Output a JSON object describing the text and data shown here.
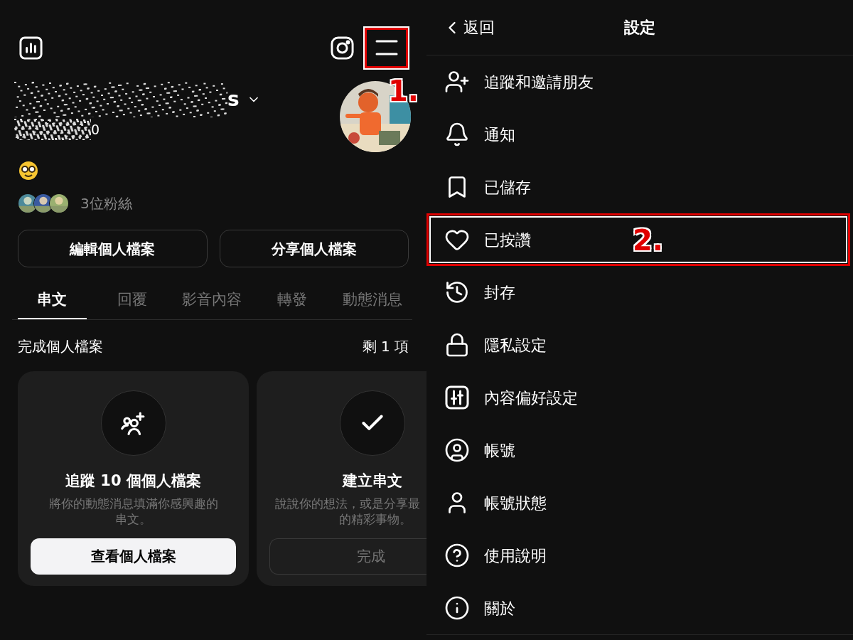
{
  "profile": {
    "header": {
      "menu_button": {
        "annotated": true,
        "marker": "1."
      }
    },
    "name_visible": "s",
    "handle_visible": "0",
    "followers": "3位粉絲",
    "buttons": [
      "編輯個人檔案",
      "分享個人檔案"
    ],
    "tabs": [
      {
        "label": "串文",
        "selected": true
      },
      {
        "label": "回覆",
        "selected": false
      },
      {
        "label": "影音內容",
        "selected": false
      },
      {
        "label": "轉發",
        "selected": false
      },
      {
        "label": "動態消息",
        "selected": false
      }
    ],
    "section": {
      "title": "完成個人檔案",
      "remaining": "剩 1 項"
    },
    "cards": [
      {
        "title": "追蹤 10 個個人檔案",
        "description": [
          "將你的動態消息填滿你感興趣的",
          "串文。"
        ],
        "button": "查看個人檔案",
        "done": false
      },
      {
        "title": "建立串文",
        "description": [
          "說說你的想法，或是分享最",
          "的精彩事物。"
        ],
        "button": "完成",
        "done": true
      }
    ]
  },
  "settings": {
    "back": "返回",
    "title": "設定",
    "items": [
      {
        "label": "追蹤和邀請朋友",
        "annotated": false
      },
      {
        "label": "通知",
        "annotated": false
      },
      {
        "label": "已儲存",
        "annotated": false
      },
      {
        "label": "已按讚",
        "annotated": true,
        "marker": "2."
      },
      {
        "label": "封存",
        "annotated": false
      },
      {
        "label": "隱私設定",
        "annotated": false
      },
      {
        "label": "內容偏好設定",
        "annotated": false
      },
      {
        "label": "帳號",
        "annotated": false
      },
      {
        "label": "帳號狀態",
        "annotated": false
      },
      {
        "label": "使用說明",
        "annotated": false
      },
      {
        "label": "關於",
        "annotated": false
      }
    ]
  }
}
